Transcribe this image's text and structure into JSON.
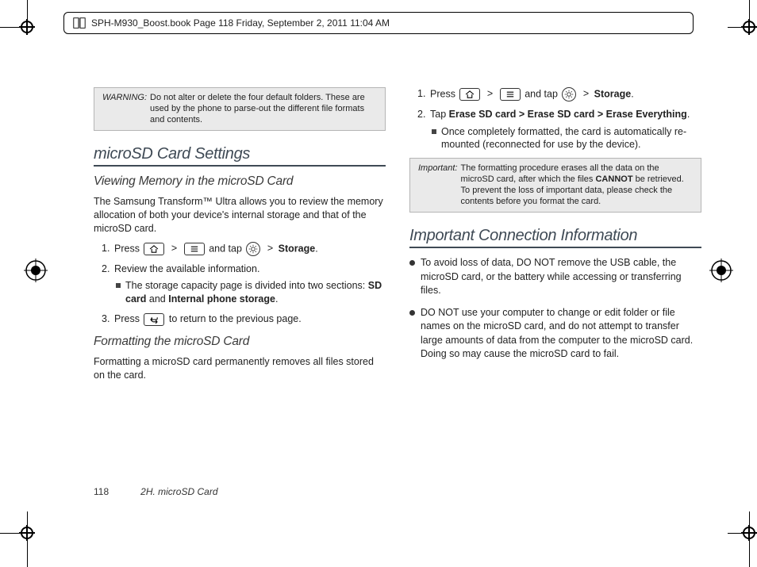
{
  "header": {
    "text": "SPH-M930_Boost.book  Page 118  Friday, September 2, 2011  11:04 AM"
  },
  "warning": {
    "label": "WARNING:",
    "text": "Do not alter or delete the four default folders. These are used by the phone to parse-out the different file formats and contents."
  },
  "section1": {
    "title": "microSD Card Settings"
  },
  "sub1": {
    "title": "Viewing Memory in the microSD Card"
  },
  "p1": "The Samsung Transform™ Ultra allows you to review the memory allocation of both your device's internal storage and that of the microSD card.",
  "step1_1a": "Press ",
  "step1_1b": " and tap ",
  "storage": "Storage",
  "gt": ">",
  "step1_2": "Review the available information.",
  "step1_2_sub_a": "The storage capacity page is divided into two sections: ",
  "sd_card": "SD card",
  "and": " and ",
  "internal": "Internal phone storage",
  "period": ".",
  "step1_3a": "Press ",
  "step1_3b": " to return to the previous page.",
  "sub2": {
    "title": "Formatting the microSD Card"
  },
  "p2": "Formatting a microSD card permanently removes all files stored on the card.",
  "step2_1a": "Press ",
  "step2_1b": " and tap ",
  "step2_2a": "Tap ",
  "erase_path": "Erase SD card > Erase SD card > Erase Everything",
  "step2_2_sub": "Once completely formatted, the card is automatically re-mounted (reconnected for use by the device).",
  "important": {
    "label": "Important:",
    "text_a": "The formatting procedure erases all the data on the microSD card, after which the files ",
    "cannot": "CANNOT",
    "text_b": " be retrieved. To prevent the loss of important data, please check the contents before you format the card."
  },
  "section2": {
    "title": "Important Connection Information"
  },
  "bul1": "To avoid loss of data, DO NOT remove the USB cable, the microSD card, or the battery while accessing or transferring files.",
  "bul2": "DO NOT use your computer to change or edit folder or file names on the microSD card, and do not attempt to transfer large amounts of data from the computer to the microSD card. Doing so may cause the microSD card to fail.",
  "footer": {
    "page": "118",
    "chapter": "2H. microSD Card"
  },
  "nums": {
    "n1": "1.",
    "n2": "2.",
    "n3": "3."
  }
}
